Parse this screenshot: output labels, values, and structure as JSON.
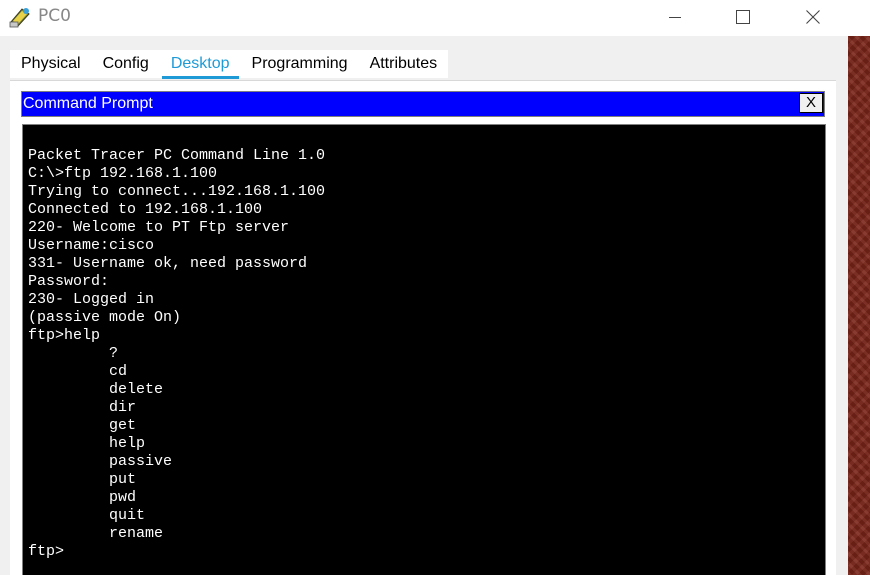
{
  "window": {
    "title": "PC0",
    "controls": {
      "minimize": "minimize-icon",
      "maximize": "maximize-icon",
      "close": "close-icon"
    }
  },
  "tabs": [
    {
      "label": "Physical",
      "active": false
    },
    {
      "label": "Config",
      "active": false
    },
    {
      "label": "Desktop",
      "active": true
    },
    {
      "label": "Programming",
      "active": false
    },
    {
      "label": "Attributes",
      "active": false
    }
  ],
  "command_prompt": {
    "title": "Command Prompt",
    "close_label": "X",
    "lines": [
      "",
      "Packet Tracer PC Command Line 1.0",
      "C:\\>ftp 192.168.1.100",
      "Trying to connect...192.168.1.100",
      "Connected to 192.168.1.100",
      "220- Welcome to PT Ftp server",
      "Username:cisco",
      "331- Username ok, need password",
      "Password:",
      "230- Logged in",
      "(passive mode On)",
      "ftp>help",
      "         ?",
      "         cd",
      "         delete",
      "         dir",
      "         get",
      "         help",
      "         passive",
      "         put",
      "         pwd",
      "         quit",
      "         rename",
      "ftp>"
    ]
  },
  "colors": {
    "active_tab": "#1e9bd7",
    "prompt_titlebar": "#0000ff",
    "terminal_bg": "#000000",
    "terminal_fg": "#ffffff"
  }
}
